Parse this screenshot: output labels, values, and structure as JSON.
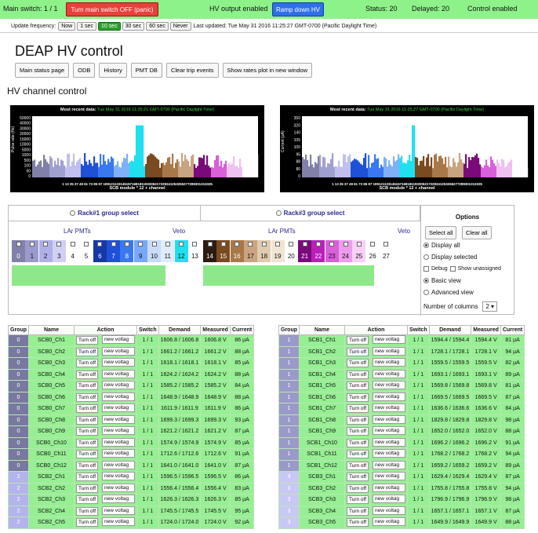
{
  "status": {
    "main_switch": "Main switch: 1 / 1",
    "panic_label": "Turn main switch OFF (panic)",
    "hv_output": "HV output enabled",
    "ramp_label": "Ramp down HV",
    "status": "Status: 20",
    "delayed": "Delayed: 20",
    "control": "Control enabled"
  },
  "freq": {
    "label": "Update frequency:",
    "options": [
      "Now",
      "1 sec",
      "10 sec",
      "30 sec",
      "60 sec",
      "Never"
    ],
    "selected": "10 sec",
    "last_updated": "Last updated: Tue May 31 2016 11:25:27 GMT-0700 (Pacific Daylight Time)"
  },
  "page_title": "DEAP HV control",
  "nav": [
    "Main status page",
    "ODB",
    "History",
    "PMT DB",
    "Clear trip events",
    "Show rates plot in new window"
  ],
  "section_title": "HV channel control",
  "plots": [
    {
      "title_prefix": "Most recent data:",
      "title_time": "Tue May 31 2016 11:25:21 GMT-0700 (Pacific Daylight Time)",
      "ylabel": "Pulse rate (Hz)",
      "xlabel": "SCB module * 12 + channel",
      "yticks": [
        "50000",
        "40000",
        "30000",
        "20000",
        "15000",
        "10000",
        "5000",
        "1000",
        "500",
        "100",
        "50",
        "0"
      ]
    },
    {
      "title_prefix": "Most recent data:",
      "title_time": "Tue May 31 2016 11:25:27 GMT-0700 (Pacific Daylight Time)",
      "ylabel": "Current (µA)",
      "xlabel": "SCB module * 12 + channel",
      "yticks": [
        "350",
        "320",
        "140",
        "105",
        "100",
        "95",
        "88",
        "80",
        "0"
      ]
    }
  ],
  "plot_xticks": "1 13 25 37 49 61 73 85 97 109121133145157169181193205217229241253265277289301313325",
  "groups": {
    "rack1": "Rack#1 group select",
    "rack3": "Rack#3 group select",
    "options": "Options",
    "lar1": "LAr PMTs",
    "veto1": "Veto",
    "lar3": "LAr PMTs",
    "veto3": "Veto",
    "cells1": [
      {
        "n": "0",
        "c": "#8080a8"
      },
      {
        "n": "1",
        "c": "#9a9acc"
      },
      {
        "n": "2",
        "c": "#b0b0e8"
      },
      {
        "n": "3",
        "c": "#d0d0f4"
      },
      {
        "n": "4",
        "c": "#ffffff"
      },
      {
        "n": "5",
        "c": "#ffffff"
      },
      {
        "n": "6",
        "c": "#1438a8"
      },
      {
        "n": "7",
        "c": "#1e50d8"
      },
      {
        "n": "8",
        "c": "#3a78f0"
      },
      {
        "n": "9",
        "c": "#78a8f8"
      },
      {
        "n": "10",
        "c": "#c8dcfa"
      },
      {
        "n": "11",
        "c": "#e0ecfc"
      },
      {
        "n": "12",
        "c": "#20e0f0"
      },
      {
        "n": "13",
        "c": "#ffffff"
      }
    ],
    "cells3": [
      {
        "n": "14",
        "c": "#2a1c10"
      },
      {
        "n": "15",
        "c": "#7a4a20"
      },
      {
        "n": "16",
        "c": "#a87848"
      },
      {
        "n": "17",
        "c": "#c8a480"
      },
      {
        "n": "18",
        "c": "#e0cab0"
      },
      {
        "n": "19",
        "c": "#f0e4d4"
      },
      {
        "n": "20",
        "c": "#ffffff"
      },
      {
        "n": "21",
        "c": "#7a0a7a"
      },
      {
        "n": "22",
        "c": "#b820b8"
      },
      {
        "n": "23",
        "c": "#d860d8"
      },
      {
        "n": "24",
        "c": "#ec9cec"
      },
      {
        "n": "25",
        "c": "#f8d0f8"
      },
      {
        "n": "26",
        "c": "#ffffff"
      },
      {
        "n": "27",
        "c": "#ffffff"
      }
    ],
    "select_all": "Select all",
    "clear_all": "Clear all",
    "display_all": "Display all",
    "display_selected": "Display selected",
    "debug": "Debug",
    "show_unassigned": "Show unassigned",
    "basic_view": "Basic view",
    "advanced_view": "Advanced view",
    "num_columns_label": "Number of columns",
    "num_columns": "2"
  },
  "table_headers": [
    "Group",
    "Name",
    "Action",
    "Switch",
    "Demand",
    "Measured",
    "Current"
  ],
  "turn_off": "Turn off",
  "new_voltage": "new voltag",
  "left_rows": [
    [
      "0",
      "SCB0_Ch1",
      "1 / 1",
      "1606.8 / 1606.8",
      "1606.8 V",
      "86 µA"
    ],
    [
      "0",
      "SCB0_Ch2",
      "1 / 1",
      "1661.2 / 1661.2",
      "1661.2 V",
      "88 µA"
    ],
    [
      "0",
      "SCB0_Ch3",
      "1 / 1",
      "1618.1 / 1618.1",
      "1618.1 V",
      "85 µA"
    ],
    [
      "0",
      "SCB0_Ch4",
      "1 / 1",
      "1624.2 / 1624.2",
      "1624.2 V",
      "88 µA"
    ],
    [
      "0",
      "SCB0_Ch5",
      "1 / 1",
      "1585.2 / 1585.2",
      "1585.2 V",
      "84 µA"
    ],
    [
      "0",
      "SCB0_Ch6",
      "1 / 1",
      "1648.9 / 1648.9",
      "1648.9 V",
      "88 µA"
    ],
    [
      "0",
      "SCB0_Ch7",
      "1 / 1",
      "1611.9 / 1611.9",
      "1611.9 V",
      "86 µA"
    ],
    [
      "0",
      "SCB0_Ch8",
      "1 / 1",
      "1699.3 / 1699.3",
      "1699.3 V",
      "93 µA"
    ],
    [
      "0",
      "SCB0_Ch9",
      "1 / 1",
      "1621.2 / 1621.2",
      "1621.2 V",
      "87 µA"
    ],
    [
      "0",
      "SCB0_Ch10",
      "1 / 1",
      "1574.9 / 1574.9",
      "1574.9 V",
      "85 µA"
    ],
    [
      "0",
      "SCB0_Ch11",
      "1 / 1",
      "1712.6 / 1712.6",
      "1712.6 V",
      "91 µA"
    ],
    [
      "0",
      "SCB0_Ch12",
      "1 / 1",
      "1641.0 / 1641.0",
      "1641.0 V",
      "87 µA"
    ],
    [
      "2",
      "SCB2_Ch1",
      "1 / 1",
      "1596.5 / 1596.5",
      "1596.5 V",
      "86 µA"
    ],
    [
      "2",
      "SCB2_Ch2",
      "1 / 1",
      "1556.4 / 1556.4",
      "1556.4 V",
      "83 µA"
    ],
    [
      "2",
      "SCB2_Ch3",
      "1 / 1",
      "1626.3 / 1626.3",
      "1626.3 V",
      "85 µA"
    ],
    [
      "2",
      "SCB2_Ch4",
      "1 / 1",
      "1745.5 / 1745.5",
      "1745.5 V",
      "95 µA"
    ],
    [
      "2",
      "SCB2_Ch5",
      "1 / 1",
      "1724.0 / 1724.0",
      "1724.0 V",
      "92 µA"
    ]
  ],
  "right_rows": [
    [
      "1",
      "SCB1_Ch1",
      "1 / 1",
      "1594.4 / 1594.4",
      "1594.4 V",
      "81 µA"
    ],
    [
      "1",
      "SCB1_Ch2",
      "1 / 1",
      "1728.1 / 1728.1",
      "1728.1 V",
      "94 µA"
    ],
    [
      "1",
      "SCB1_Ch3",
      "1 / 1",
      "1559.5 / 1559.5",
      "1559.5 V",
      "82 µA"
    ],
    [
      "1",
      "SCB1_Ch4",
      "1 / 1",
      "1693.1 / 1693.1",
      "1693.1 V",
      "89 µA"
    ],
    [
      "1",
      "SCB1_Ch5",
      "1 / 1",
      "1569.8 / 1569.8",
      "1569.8 V",
      "81 µA"
    ],
    [
      "1",
      "SCB1_Ch6",
      "1 / 1",
      "1669.5 / 1669.5",
      "1669.5 V",
      "87 µA"
    ],
    [
      "1",
      "SCB1_Ch7",
      "1 / 1",
      "1636.6 / 1636.6",
      "1636.6 V",
      "84 µA"
    ],
    [
      "1",
      "SCB1_Ch8",
      "1 / 1",
      "1829.8 / 1829.8",
      "1829.8 V",
      "98 µA"
    ],
    [
      "1",
      "SCB1_Ch9",
      "1 / 1",
      "1652.0 / 1652.0",
      "1652.0 V",
      "88 µA"
    ],
    [
      "1",
      "SCB1_Ch10",
      "1 / 1",
      "1696.2 / 1696.2",
      "1696.2 V",
      "91 µA"
    ],
    [
      "1",
      "SCB1_Ch11",
      "1 / 1",
      "1768.2 / 1768.2",
      "1768.2 V",
      "94 µA"
    ],
    [
      "1",
      "SCB1_Ch12",
      "1 / 1",
      "1659.2 / 1659.2",
      "1659.2 V",
      "89 µA"
    ],
    [
      "3",
      "SCB3_Ch1",
      "1 / 1",
      "1629.4 / 1629.4",
      "1629.4 V",
      "87 µA"
    ],
    [
      "3",
      "SCB3_Ch2",
      "1 / 1",
      "1755.8 / 1755.8",
      "1755.8 V",
      "94 µA"
    ],
    [
      "3",
      "SCB3_Ch3",
      "1 / 1",
      "1796.9 / 1796.9",
      "1796.9 V",
      "98 µA"
    ],
    [
      "3",
      "SCB3_Ch4",
      "1 / 1",
      "1657.1 / 1657.1",
      "1657.1 V",
      "87 µA"
    ],
    [
      "3",
      "SCB3_Ch5",
      "1 / 1",
      "1649.9 / 1649.9",
      "1649.9 V",
      "88 µA"
    ]
  ],
  "group_colors": {
    "0": "#7878a0",
    "1": "#9a9ac8",
    "2": "#b4b4ec",
    "3": "#c8c8f4"
  }
}
